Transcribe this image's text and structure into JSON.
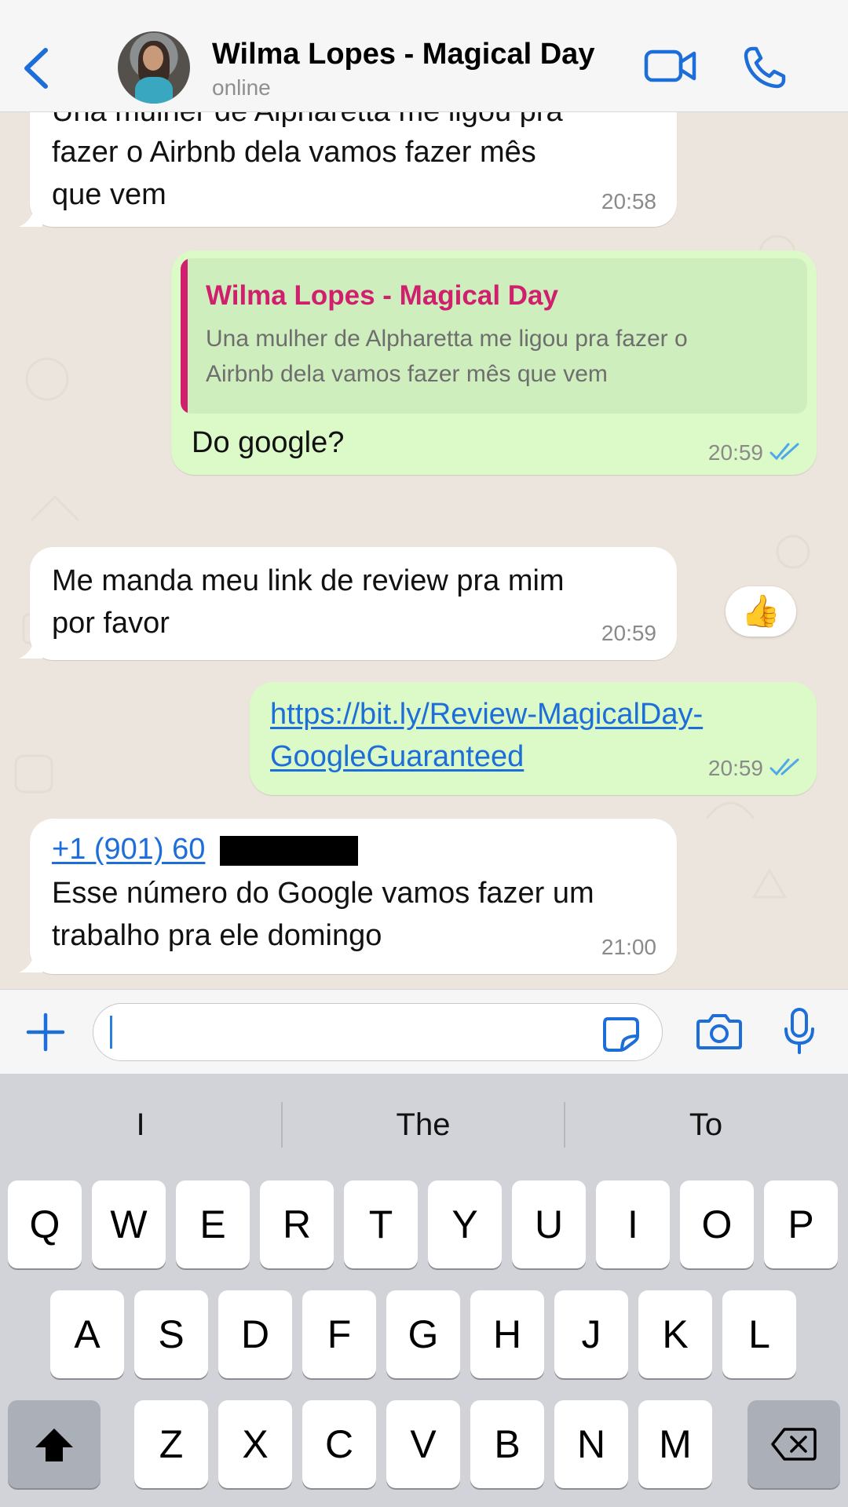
{
  "header": {
    "contact_name": "Wilma Lopes - Magical Day",
    "status": "online"
  },
  "messages": [
    {
      "direction": "incoming",
      "lines": [
        "Una mulher de Alpharetta me ligou pra",
        "fazer o Airbnb dela vamos fazer mês",
        "que vem"
      ],
      "time": "20:58"
    },
    {
      "direction": "outgoing",
      "quote": {
        "author": "Wilma Lopes - Magical Day",
        "lines": [
          "Una mulher de Alpharetta me ligou pra fazer o",
          "Airbnb dela vamos fazer mês que vem"
        ]
      },
      "text": "Do google?",
      "time": "20:59",
      "status": "read",
      "reaction": "👍"
    },
    {
      "direction": "incoming",
      "lines": [
        "Me manda meu link de review pra mim",
        "por favor"
      ],
      "time": "20:59"
    },
    {
      "direction": "outgoing",
      "link_lines": [
        "https://bit.ly/Review-MagicalDay-",
        "GoogleGuaranteed"
      ],
      "time": "20:59",
      "status": "read"
    },
    {
      "direction": "incoming",
      "phone_partial": "+1 (901) 60",
      "phone_redacted": true,
      "lines": [
        "Esse número do Google vamos fazer um",
        "trabalho pra ele domingo"
      ],
      "time": "21:00"
    }
  ],
  "composer": {
    "value": "",
    "placeholder": ""
  },
  "keyboard": {
    "suggestions": [
      "I",
      "The",
      "To"
    ],
    "row1": [
      "Q",
      "W",
      "E",
      "R",
      "T",
      "Y",
      "U",
      "I",
      "O",
      "P"
    ],
    "row2": [
      "A",
      "S",
      "D",
      "F",
      "G",
      "H",
      "J",
      "K",
      "L"
    ],
    "row3": [
      "Z",
      "X",
      "C",
      "V",
      "B",
      "N",
      "M"
    ]
  },
  "colors": {
    "accent": "#1d6ed8",
    "outgoing_bubble": "#dbfac8",
    "incoming_bubble": "#ffffff",
    "quote_author": "#d01f6d",
    "chat_background": "#ece5dd"
  }
}
